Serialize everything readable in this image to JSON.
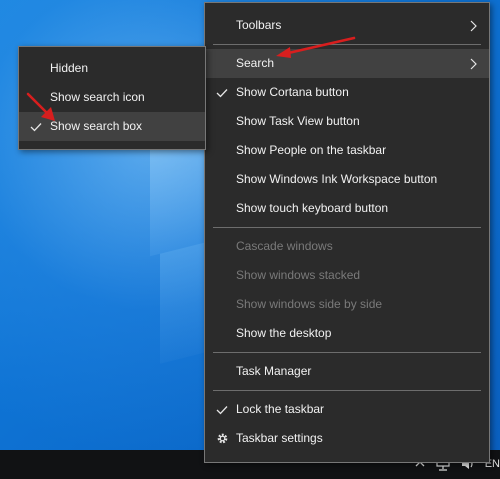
{
  "main_menu": {
    "toolbars": "Toolbars",
    "search": "Search",
    "show_cortana": "Show Cortana button",
    "show_task_view": "Show Task View button",
    "show_people": "Show People on the taskbar",
    "show_ink": "Show Windows Ink Workspace button",
    "show_touch_keyboard": "Show touch keyboard button",
    "cascade": "Cascade windows",
    "stacked": "Show windows stacked",
    "side_by_side": "Show windows side by side",
    "show_desktop": "Show the desktop",
    "task_manager": "Task Manager",
    "lock_taskbar": "Lock the taskbar",
    "taskbar_settings": "Taskbar settings"
  },
  "search_submenu": {
    "hidden": "Hidden",
    "show_icon": "Show search icon",
    "show_box": "Show search box"
  },
  "tray": {
    "language": "EN"
  },
  "colors": {
    "menu_bg": "#2b2b2b",
    "hover_bg": "#414141",
    "disabled_text": "#7a7a7a",
    "annotation_arrow": "#d81e1e"
  }
}
